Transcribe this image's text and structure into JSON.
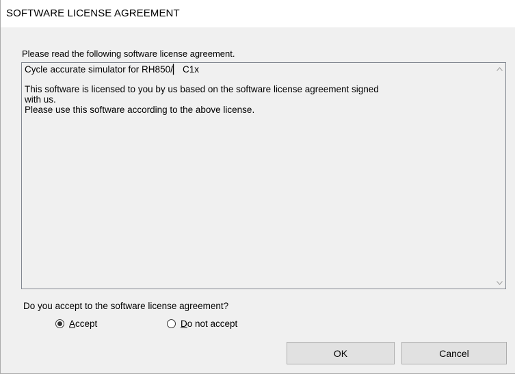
{
  "window": {
    "title": "SOFTWARE LICENSE AGREEMENT"
  },
  "intro_label": "Please read the following software license agreement.",
  "license_text": {
    "lines": [
      "Cycle accurate simulator for RH850/▏ C1x",
      "",
      "This software is licensed to you by us based on the software license agreement signed",
      "with us.",
      "Please use this software according to the above license."
    ]
  },
  "question_label": "Do you accept to the software license agreement?",
  "options": {
    "accept": {
      "mnemonic": "A",
      "rest": "ccept",
      "selected": true
    },
    "do_not_accept": {
      "mnemonic": "D",
      "rest": "o not accept",
      "selected": false
    }
  },
  "buttons": {
    "ok": "OK",
    "cancel": "Cancel"
  },
  "icons": {
    "scroll_up": "chevron-up-icon",
    "scroll_down": "chevron-down-icon"
  },
  "colors": {
    "dialog_background": "#f0f0f0",
    "titlebar_background": "#ffffff",
    "button_face": "#e1e1e1",
    "border": "#828790"
  }
}
